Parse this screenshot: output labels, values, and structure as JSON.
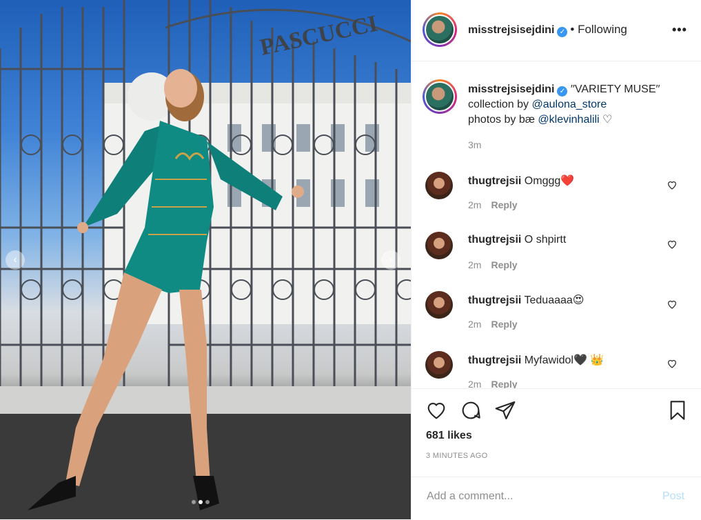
{
  "post": {
    "username": "misstrejsisejdini",
    "follow_status": "• Following",
    "more_label": "•••",
    "caption": {
      "username": "misstrejsisejdini",
      "line1_text": "′′VARIETY MUSE′′",
      "line2_text": "collection by",
      "line2_link": "@aulona_store",
      "line3_text": "photos by bæ",
      "line3_link": "@klevinhalili",
      "time": "3m"
    },
    "comments": [
      {
        "user": "thugtrejsii",
        "text": "Omggg",
        "emoji": "❤️",
        "time": "2m",
        "reply": "Reply"
      },
      {
        "user": "thugtrejsii",
        "text": "O shpirtt",
        "emoji": "",
        "time": "2m",
        "reply": "Reply"
      },
      {
        "user": "thugtrejsii",
        "text": "Teduaaaa",
        "emoji": "😍",
        "time": "2m",
        "reply": "Reply"
      },
      {
        "user": "thugtrejsii",
        "text": "Myfawidol",
        "emoji": "🖤 👑",
        "time": "2m",
        "reply": "Reply"
      }
    ],
    "likes": "681 likes",
    "posted": "3 MINUTES AGO",
    "comment_placeholder": "Add a comment...",
    "post_label": "Post",
    "image_sign": "PASCUCCI",
    "carousel": {
      "total": 3,
      "active": 2
    }
  },
  "colors": {
    "link": "#00376b",
    "verified": "#3897f0",
    "post_disabled": "#b2dffc",
    "meta": "#8e8e8e"
  }
}
